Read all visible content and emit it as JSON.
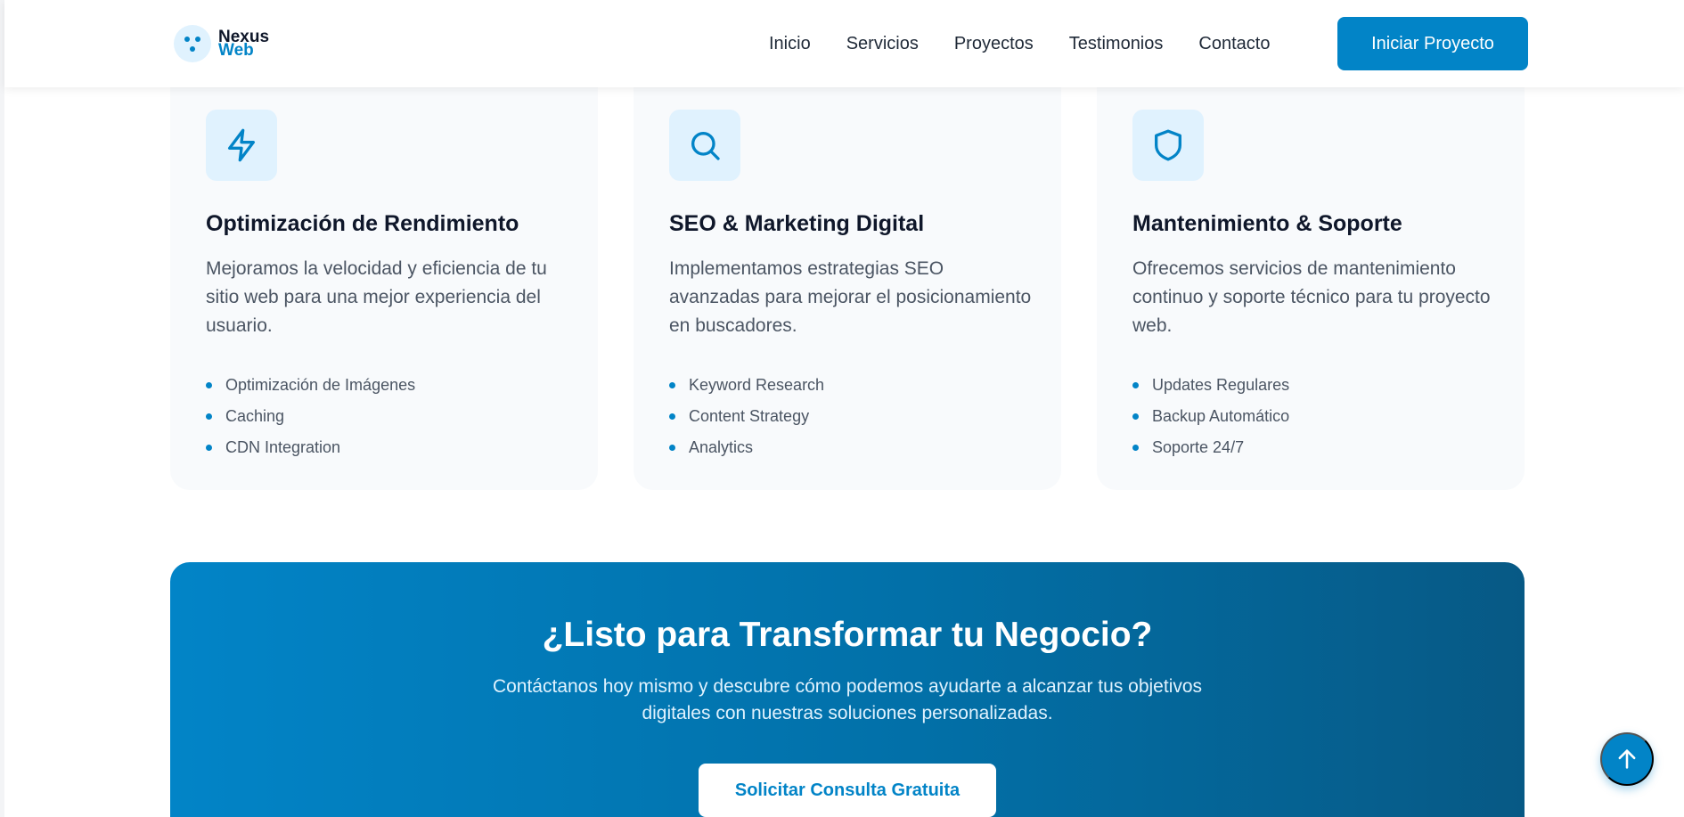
{
  "brand": {
    "line1": "Nexus",
    "line2": "Web"
  },
  "nav": {
    "items": [
      "Inicio",
      "Servicios",
      "Proyectos",
      "Testimonios",
      "Contacto"
    ],
    "cta": "Iniciar Proyecto"
  },
  "services": [
    {
      "icon": "lightning-icon",
      "title": "Optimización de Rendimiento",
      "description": "Mejoramos la velocidad y eficiencia de tu sitio web para una mejor experiencia del usuario.",
      "features": [
        "Optimización de Imágenes",
        "Caching",
        "CDN Integration"
      ]
    },
    {
      "icon": "search-icon",
      "title": "SEO & Marketing Digital",
      "description": "Implementamos estrategias SEO avanzadas para mejorar el posicionamiento en buscadores.",
      "features": [
        "Keyword Research",
        "Content Strategy",
        "Analytics"
      ]
    },
    {
      "icon": "shield-icon",
      "title": "Mantenimiento & Soporte",
      "description": "Ofrecemos servicios de mantenimiento continuo y soporte técnico para tu proyecto web.",
      "features": [
        "Updates Regulares",
        "Backup Automático",
        "Soporte 24/7"
      ]
    }
  ],
  "banner": {
    "title": "¿Listo para Transformar tu Negocio?",
    "text": "Contáctanos hoy mismo y descubre cómo podemos ayudarte a alcanzar tus objetivos digitales con nuestras soluciones personalizadas.",
    "cta": "Solicitar Consulta Gratuita"
  },
  "scroll_top_icon": "arrow-up-icon",
  "colors": {
    "primary": "#0284c7",
    "primary_dark": "#075985",
    "icon_bg": "#e0f2fe",
    "card_bg": "#f8fafc",
    "heading": "#0f172a",
    "body_text": "#4b5563"
  }
}
